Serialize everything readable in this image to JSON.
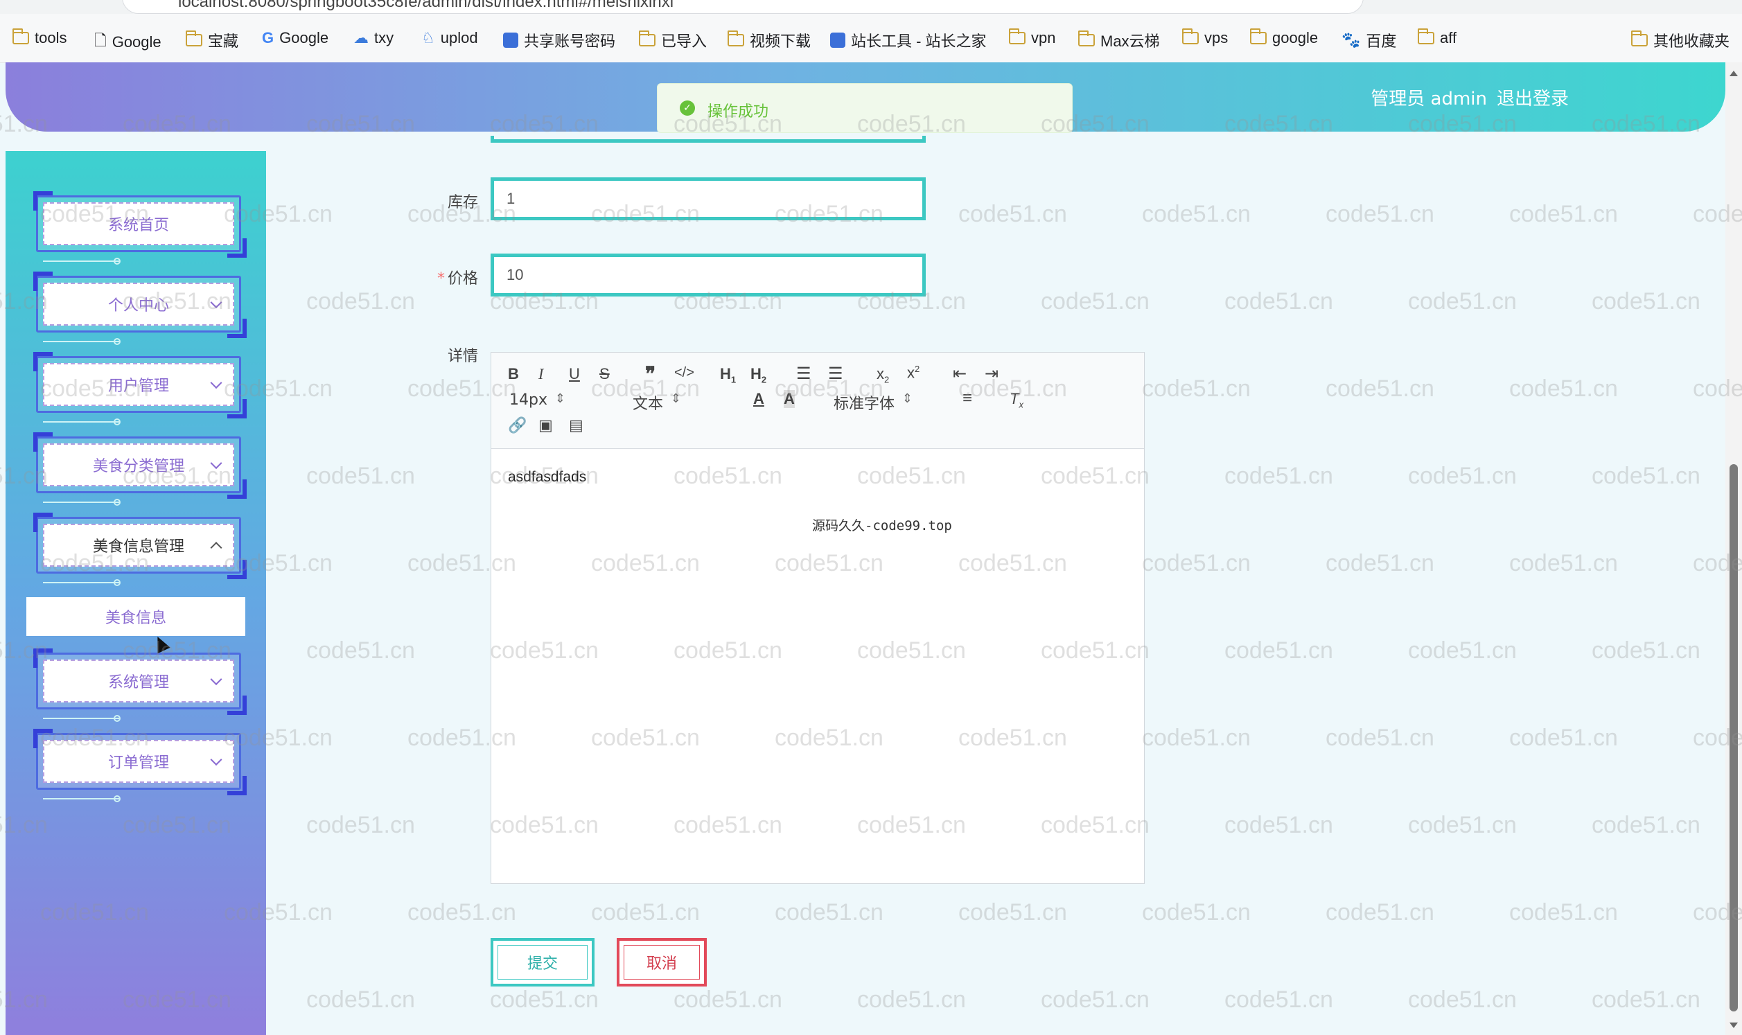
{
  "browser": {
    "address_partial": "localhost:8080/springboot35c8fe/admin/dist/index.html#/meishixinxi",
    "bookmarks": [
      {
        "label": "tools",
        "icon": "folder-icon"
      },
      {
        "label": "Google",
        "icon": "page-icon"
      },
      {
        "label": "宝藏",
        "icon": "folder-icon"
      },
      {
        "label": "Google",
        "icon": "google-icon"
      },
      {
        "label": "txy",
        "icon": "cloud-icon"
      },
      {
        "label": "uplod",
        "icon": "upload-icon"
      },
      {
        "label": "共享账号密码",
        "icon": "share-icon"
      },
      {
        "label": "已导入",
        "icon": "folder-icon"
      },
      {
        "label": "视频下载",
        "icon": "folder-icon"
      },
      {
        "label": "站长工具 - 站长之家",
        "icon": "site-icon"
      },
      {
        "label": "vpn",
        "icon": "folder-icon"
      },
      {
        "label": "Max云梯",
        "icon": "folder-icon"
      },
      {
        "label": "vps",
        "icon": "folder-icon"
      },
      {
        "label": "google",
        "icon": "folder-icon"
      },
      {
        "label": "百度",
        "icon": "baidu-icon"
      },
      {
        "label": "aff",
        "icon": "folder-icon"
      },
      {
        "label": "其他收藏夹",
        "icon": "folder-icon"
      }
    ]
  },
  "header": {
    "user_label": "管理员 admin",
    "logout_label": "退出登录"
  },
  "toast": {
    "message": "操作成功",
    "color": "#67c23a"
  },
  "sidebar": {
    "items": [
      {
        "label": "系统首页",
        "has_arrow": false
      },
      {
        "label": "个人中心",
        "has_arrow": true
      },
      {
        "label": "用户管理",
        "has_arrow": true
      },
      {
        "label": "美食分类管理",
        "has_arrow": true
      },
      {
        "label": "美食信息管理",
        "has_arrow": true,
        "expanded": true
      },
      {
        "label": "系统管理",
        "has_arrow": true
      },
      {
        "label": "订单管理",
        "has_arrow": true
      }
    ],
    "submenu_item": "美食信息"
  },
  "form": {
    "stock_label": "库存",
    "stock_value": "1",
    "price_label": "价格",
    "price_value": "10",
    "detail_label": "详情"
  },
  "editor": {
    "font_size": "14px",
    "block_type": "文本",
    "font_family": "标准字体",
    "content": "asdfasdfads"
  },
  "overlay_note": "源码久久-code99.top",
  "buttons": {
    "submit": "提交",
    "cancel": "取消"
  },
  "watermark": "code51.cn",
  "colors": {
    "accent": "#3cc8c2",
    "danger": "#e24a5a",
    "sidebar_text": "#8a6bd1"
  }
}
